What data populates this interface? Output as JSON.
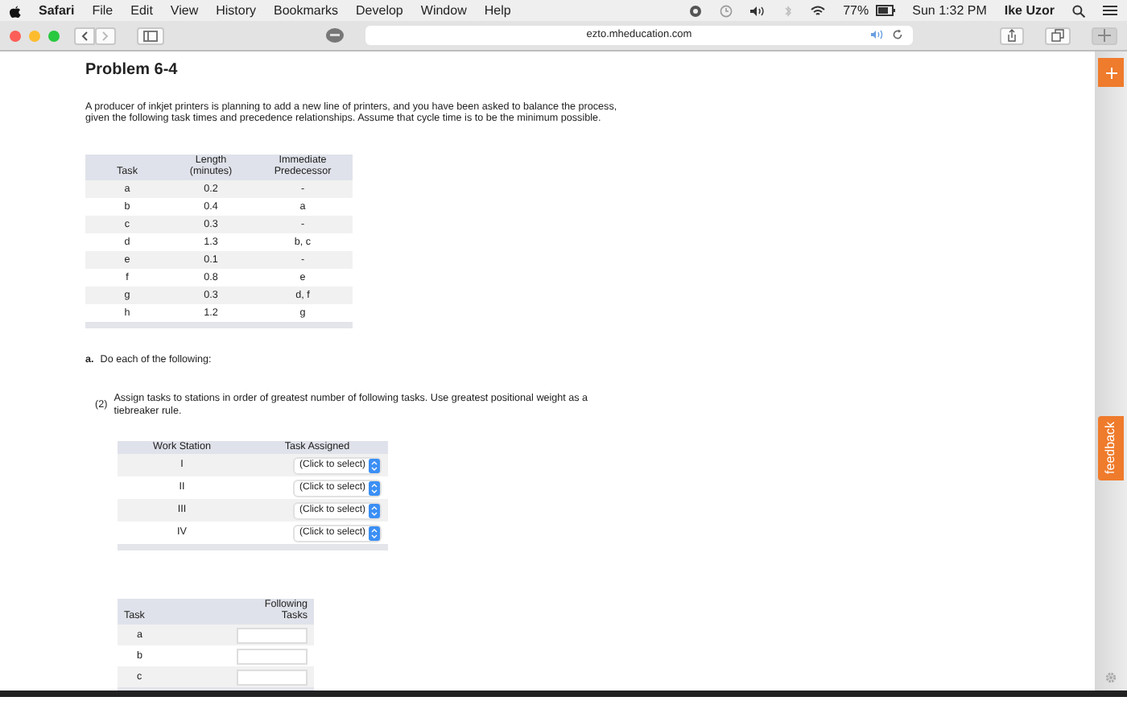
{
  "menubar": {
    "app": "Safari",
    "menus": [
      "File",
      "Edit",
      "View",
      "History",
      "Bookmarks",
      "Develop",
      "Window",
      "Help"
    ],
    "battery": "77%",
    "time": "Sun 1:32 PM",
    "user": "Ike Uzor"
  },
  "toolbar": {
    "url": "ezto.mheducation.com"
  },
  "problem": {
    "title": "Problem 6-4",
    "intro": "A producer of inkjet printers is planning to add a new line of printers, and you have been asked to balance the process, given the following task times and precedence relationships. Assume that cycle time is to be the minimum possible.",
    "table": {
      "columns": [
        "Task",
        "Length (minutes)",
        "Immediate Predecessor"
      ],
      "rows": [
        [
          "a",
          "0.2",
          "-"
        ],
        [
          "b",
          "0.4",
          "a"
        ],
        [
          "c",
          "0.3",
          "-"
        ],
        [
          "d",
          "1.3",
          "b, c"
        ],
        [
          "e",
          "0.1",
          "-"
        ],
        [
          "f",
          "0.8",
          "e"
        ],
        [
          "g",
          "0.3",
          "d, f"
        ],
        [
          "h",
          "1.2",
          "g"
        ]
      ]
    }
  },
  "part_a": {
    "label": "a.",
    "text": "Do each of the following:"
  },
  "question": {
    "number": "(2)",
    "text": "Assign tasks to stations in order of greatest number of following tasks. Use greatest positional weight as a tiebreaker rule."
  },
  "assign_table": {
    "columns": [
      "Work Station",
      "Task Assigned"
    ],
    "rows": [
      {
        "station": "I",
        "select": "(Click to select)"
      },
      {
        "station": "II",
        "select": "(Click to select)"
      },
      {
        "station": "III",
        "select": "(Click to select)"
      },
      {
        "station": "IV",
        "select": "(Click to select)"
      }
    ]
  },
  "following_table": {
    "columns": [
      "Task",
      "Following Tasks"
    ],
    "rows": [
      {
        "task": "a"
      },
      {
        "task": "b"
      },
      {
        "task": "c"
      }
    ]
  },
  "feedback": "feedback"
}
